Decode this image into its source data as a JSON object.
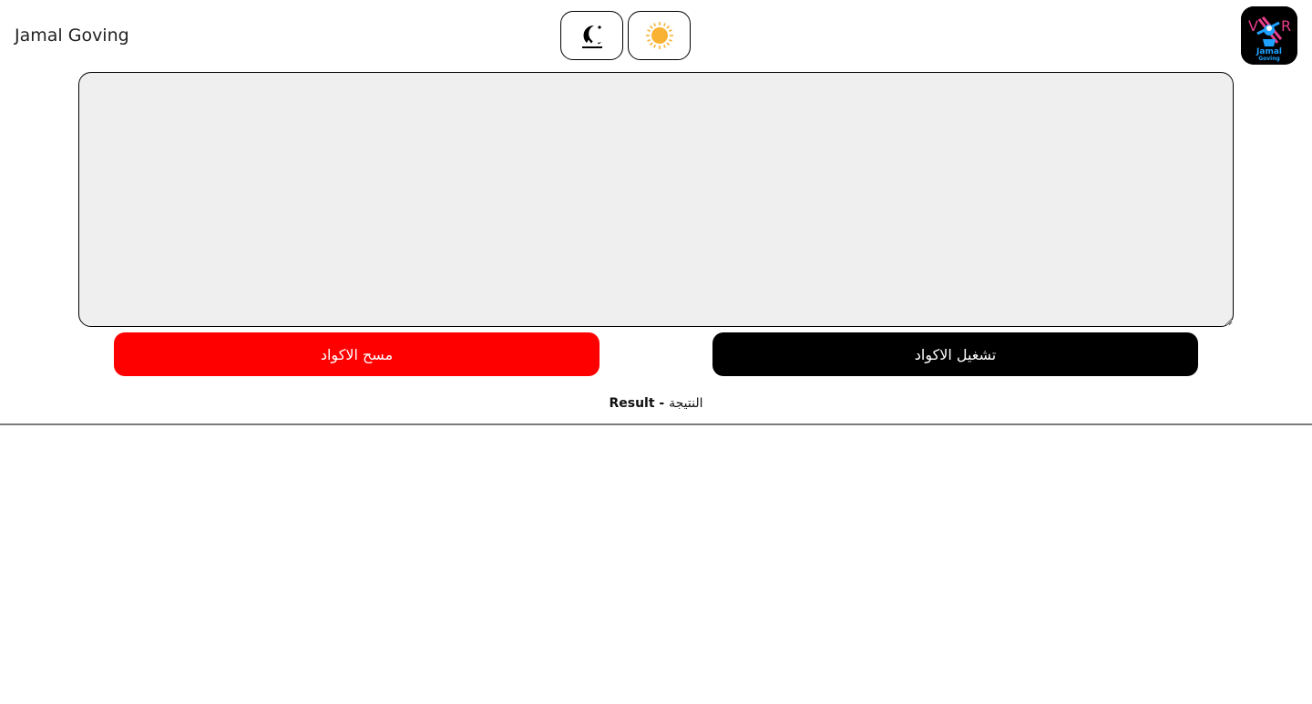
{
  "header": {
    "brand_name": "Jamal Goving",
    "dark_mode_icon": "moon-icon",
    "light_mode_icon": "sun-icon",
    "logo": {
      "text_top": "Jamal",
      "text_bottom": "Goving"
    }
  },
  "editor": {
    "value": "",
    "placeholder": ""
  },
  "actions": {
    "clear_label": "مسح الاكواد",
    "run_label": "تشغيل الاكواد"
  },
  "result": {
    "label_en": "Result",
    "separator": " - ",
    "label_ar": "النتيجة"
  },
  "colors": {
    "clear_button": "#ff0000",
    "run_button": "#000000",
    "editor_bg": "#efefef",
    "sun": "#f9b233"
  }
}
